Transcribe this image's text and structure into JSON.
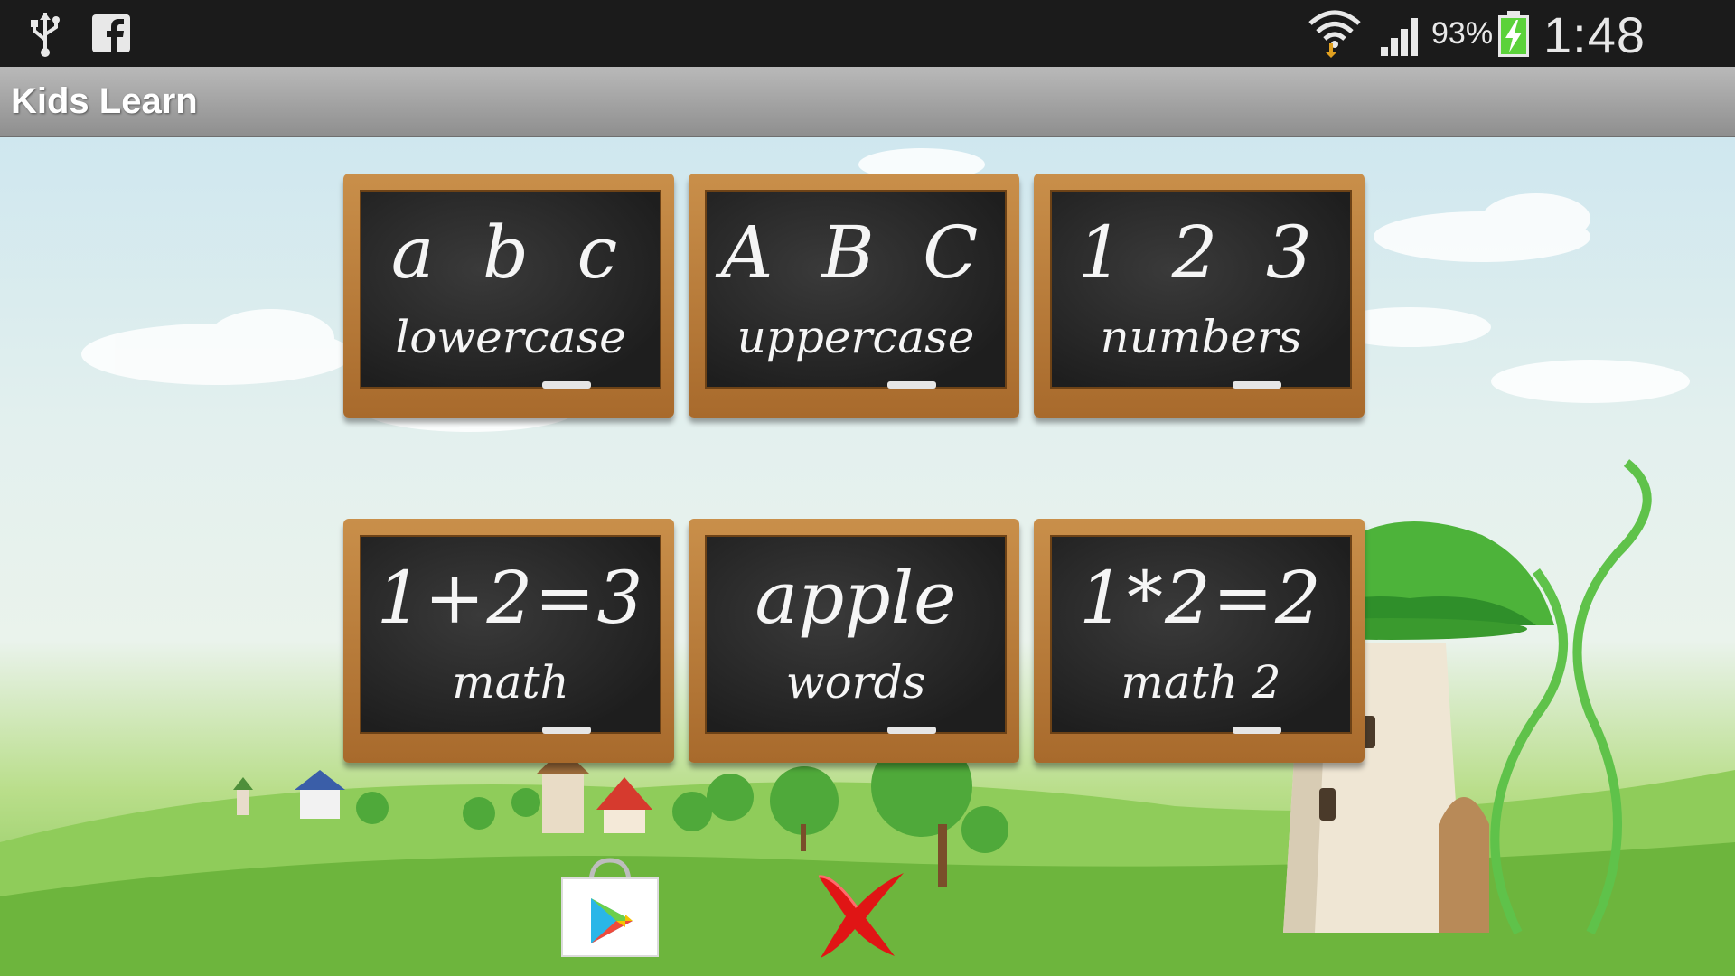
{
  "status_bar": {
    "battery_percent": "93%",
    "time": "1:48 PM",
    "icons": [
      "usb-icon",
      "facebook-icon",
      "wifi-icon",
      "signal-icon",
      "battery-charging-icon"
    ]
  },
  "action_bar": {
    "title": "Kids Learn"
  },
  "menu": {
    "tiles": [
      {
        "id": "lowercase",
        "symbols": "a b c",
        "label": "lowercase"
      },
      {
        "id": "uppercase",
        "symbols": "A B C",
        "label": "uppercase"
      },
      {
        "id": "numbers",
        "symbols": "1 2 3",
        "label": "numbers"
      },
      {
        "id": "math",
        "symbols": "1+2=3",
        "label": "math"
      },
      {
        "id": "words",
        "symbols": "apple",
        "label": "words"
      },
      {
        "id": "math2",
        "symbols": "1*2=2",
        "label": "math 2"
      }
    ]
  },
  "bottom_buttons": {
    "icons": [
      "play-store-icon",
      "exit-x-icon"
    ]
  },
  "colors": {
    "status_bar_bg": "#1b1b1b",
    "action_bar_bg": "#a6a6a6",
    "board_frame": "#b87a36",
    "board_slate": "#262626",
    "chalk_text": "#f5f5f5",
    "battery_green": "#5bd23a",
    "exit_red": "#e01515"
  }
}
